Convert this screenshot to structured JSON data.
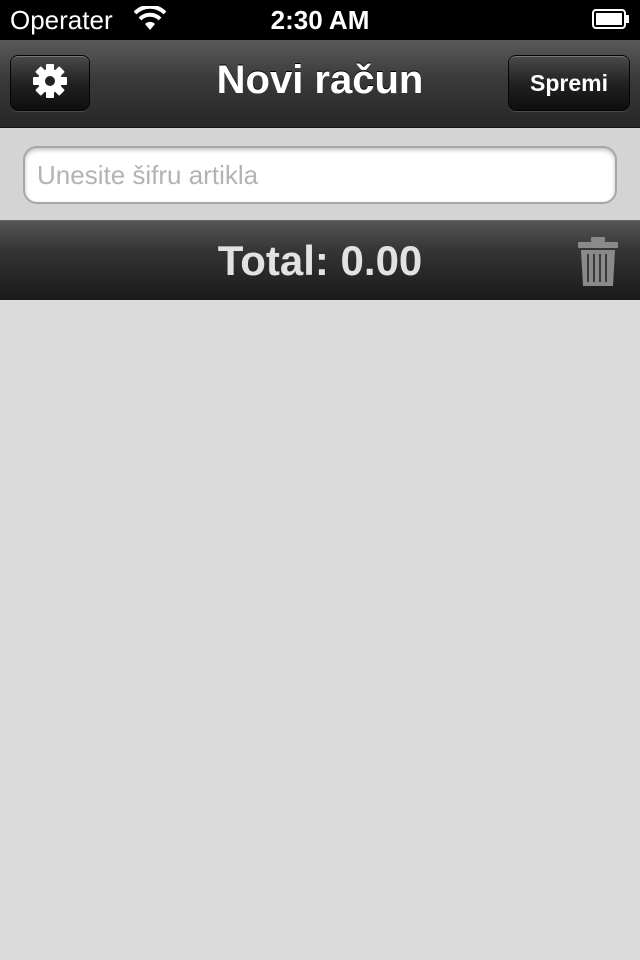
{
  "status_bar": {
    "carrier": "Operater",
    "time": "2:30 AM",
    "wifi_icon": "wifi-icon",
    "battery_icon": "battery-icon"
  },
  "nav_bar": {
    "title": "Novi račun",
    "settings_icon": "gear-icon",
    "save_label": "Spremi"
  },
  "search": {
    "placeholder": "Unesite šifru artikla",
    "value": ""
  },
  "total_bar": {
    "total_text": "Total: 0.00",
    "trash_icon": "trash-icon"
  },
  "colors": {
    "background": "#dbdbdb",
    "nav_dark": "#262626",
    "text_light": "#e2e2e2"
  }
}
